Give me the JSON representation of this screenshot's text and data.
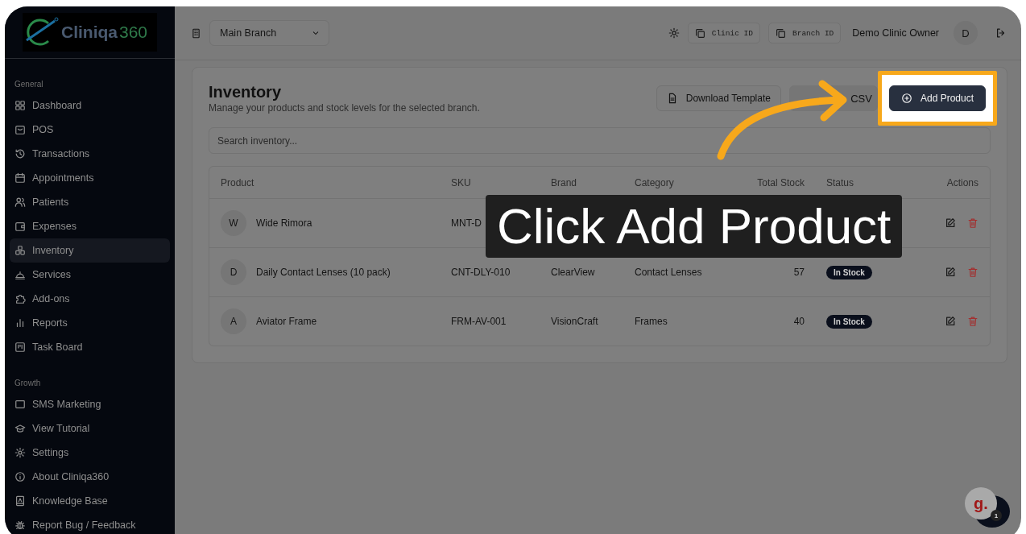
{
  "logo": {
    "name": "Cliniqa",
    "accent": "360"
  },
  "sidebar": {
    "sections": [
      {
        "label": "General",
        "items": [
          {
            "label": "Dashboard",
            "selected": false
          },
          {
            "label": "POS",
            "selected": false
          },
          {
            "label": "Transactions",
            "selected": false
          },
          {
            "label": "Appointments",
            "selected": false
          },
          {
            "label": "Patients",
            "selected": false
          },
          {
            "label": "Expenses",
            "selected": false
          },
          {
            "label": "Inventory",
            "selected": true
          },
          {
            "label": "Services",
            "selected": false
          },
          {
            "label": "Add-ons",
            "selected": false
          },
          {
            "label": "Reports",
            "selected": false
          },
          {
            "label": "Task Board",
            "selected": false
          }
        ]
      },
      {
        "label": "Growth",
        "items": [
          {
            "label": "SMS Marketing",
            "selected": false
          }
        ]
      }
    ],
    "footer": [
      "View Tutorial",
      "Settings",
      "About Cliniqa360",
      "Knowledge Base",
      "Report Bug / Feedback"
    ]
  },
  "header": {
    "branch": "Main Branch",
    "clinic_id": "Clinic ID",
    "branch_id": "Branch ID",
    "user": "Demo Clinic Owner",
    "avatar": "D"
  },
  "page": {
    "title": "Inventory",
    "subtitle": "Manage your products and stock levels for the selected branch.",
    "buttons": [
      {
        "label": "Download Template",
        "kind": "outline",
        "highlighted": false
      },
      {
        "label": "CSV",
        "kind": "secondary",
        "highlighted": false
      },
      {
        "label": "Add Product",
        "kind": "primary",
        "highlighted": true
      }
    ],
    "search": {
      "placeholder": "Search inventory..."
    }
  },
  "table": {
    "columns": [
      "Product",
      "SKU",
      "Brand",
      "Category",
      "Total Stock",
      "Status",
      "Actions"
    ],
    "rows": [
      {
        "initial": "W",
        "name": "Wide Rimora",
        "sku": "MNT-D"
      },
      {
        "initial": "D",
        "name": "Daily Contact Lenses (10 pack)",
        "sku": "CNT-DLY-010",
        "brand": "ClearView",
        "category": "Contact Lenses",
        "stock": "57",
        "status": "In Stock"
      },
      {
        "initial": "A",
        "name": "Aviator Frame",
        "sku": "FRM-AV-001",
        "brand": "VisionCraft",
        "category": "Frames",
        "stock": "40",
        "status": "In Stock"
      }
    ]
  },
  "callout": "Click Add Product",
  "widget": {
    "logo": "g.",
    "count": "1"
  }
}
